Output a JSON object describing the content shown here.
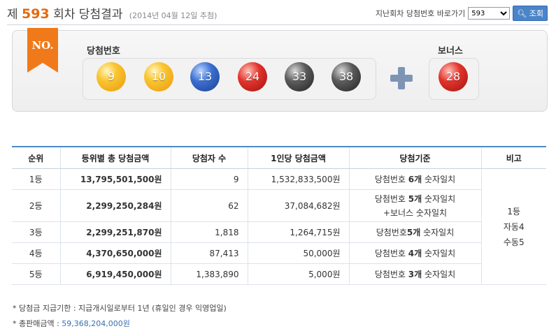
{
  "header": {
    "title_prefix": "제",
    "round": "593",
    "title_suffix": "회차 당첨결과",
    "date": "(2014년 04월 12일 추첨)",
    "nav_label": "지난회차 당첨번호 바로가기",
    "selected_round": "593",
    "search_label": "조회"
  },
  "panel": {
    "badge": "NO.",
    "winning_label": "당첨번호",
    "bonus_label": "보너스",
    "balls": [
      {
        "num": "9",
        "color": "#fbc531"
      },
      {
        "num": "10",
        "color": "#fbc531"
      },
      {
        "num": "13",
        "color": "#3a6fd1"
      },
      {
        "num": "24",
        "color": "#e2332a"
      },
      {
        "num": "33",
        "color": "#5a5a5a"
      },
      {
        "num": "38",
        "color": "#5a5a5a"
      }
    ],
    "bonus_ball": {
      "num": "28",
      "color": "#e2332a"
    }
  },
  "table": {
    "headers": [
      "순위",
      "등위별 총 당첨금액",
      "당첨자 수",
      "1인당 당첨금액",
      "당첨기준",
      "비고"
    ],
    "rows": [
      {
        "rank": "1등",
        "total": "13,795,501,500원",
        "winners": "9",
        "per": "1,532,833,500원",
        "criteria_a": "당첨번호 ",
        "criteria_b": "6개",
        "criteria_c": " 숫자일치",
        "criteria2": ""
      },
      {
        "rank": "2등",
        "total": "2,299,250,284원",
        "winners": "62",
        "per": "37,084,682원",
        "criteria_a": "당첨번호 ",
        "criteria_b": "5개",
        "criteria_c": " 숫자일치",
        "criteria2": "+보너스 숫자일치"
      },
      {
        "rank": "3등",
        "total": "2,299,251,870원",
        "winners": "1,818",
        "per": "1,264,715원",
        "criteria_a": "당첨번호",
        "criteria_b": "5개",
        "criteria_c": " 숫자일치",
        "criteria2": ""
      },
      {
        "rank": "4등",
        "total": "4,370,650,000원",
        "winners": "87,413",
        "per": "50,000원",
        "criteria_a": "당첨번호 ",
        "criteria_b": "4개",
        "criteria_c": " 숫자일치",
        "criteria2": ""
      },
      {
        "rank": "5등",
        "total": "6,919,450,000원",
        "winners": "1,383,890",
        "per": "5,000원",
        "criteria_a": "당첨번호 ",
        "criteria_b": "3개",
        "criteria_c": " 숫자일치",
        "criteria2": ""
      }
    ],
    "remark_lines": [
      "1등",
      "자동4",
      "수동5"
    ]
  },
  "notes": {
    "deadline": "* 당첨금 지급기한 : 지급개시일로부터 1년 (휴일인 경우 익영업일)",
    "sales_label": "* 총판매금액 : ",
    "sales_value": "59,368,204,000원"
  }
}
